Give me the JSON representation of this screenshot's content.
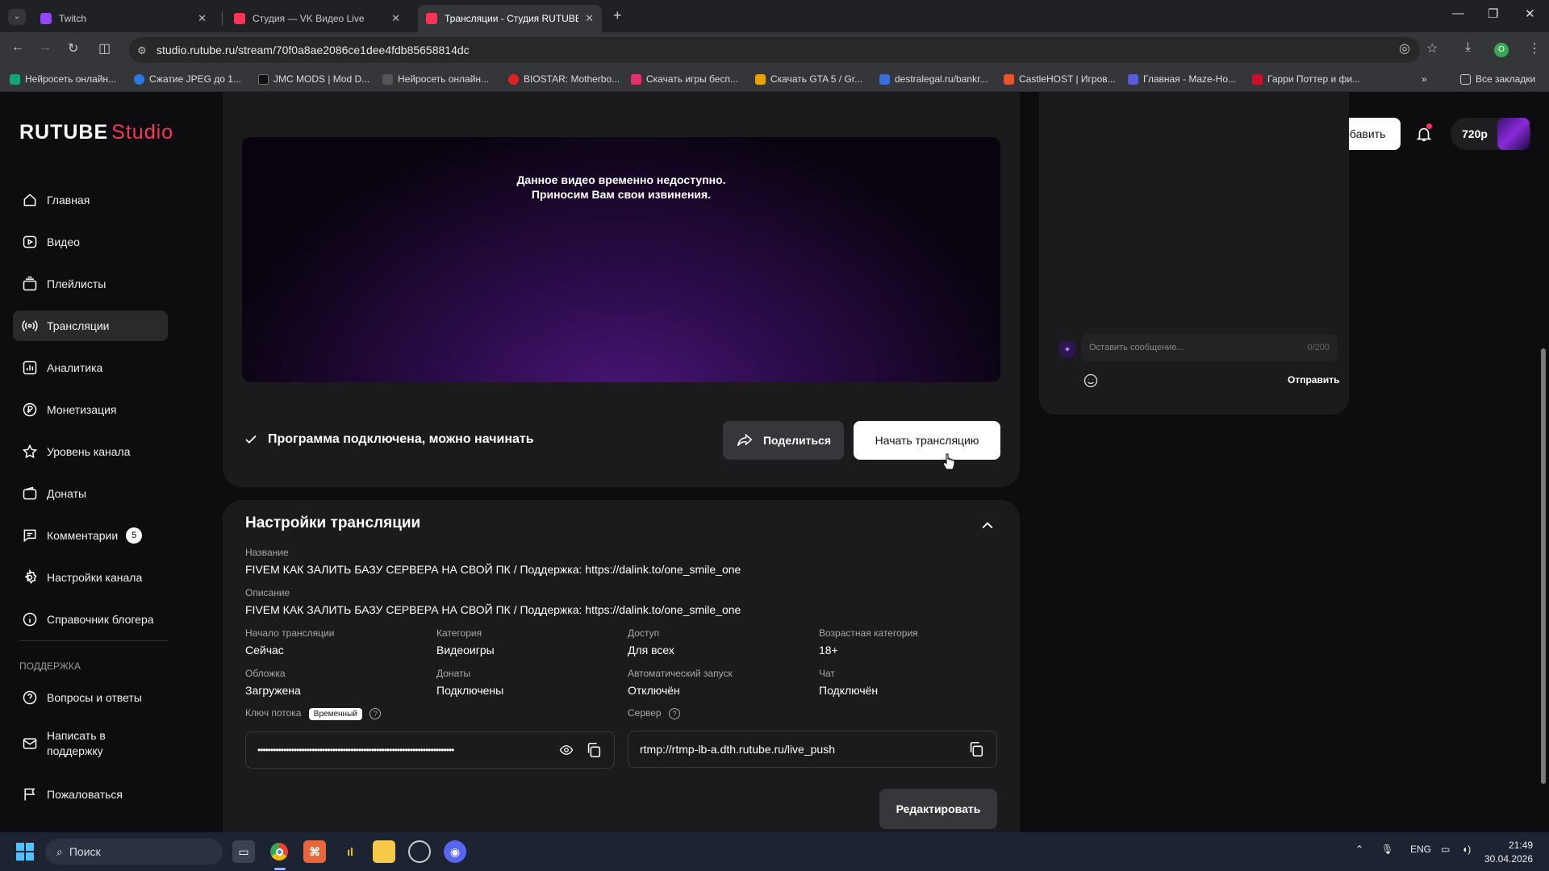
{
  "browser": {
    "tabs": [
      {
        "title": "Twitch",
        "color": "#9146ff"
      },
      {
        "title": "Студия — VK Видео Live",
        "color": "#ff3355"
      },
      {
        "title": "Трансляции - Студия RUTUBE",
        "color": "#ff3355"
      }
    ],
    "url": "studio.rutube.ru/stream/70f0a8ae2086ce1dee4fdb85658814dc",
    "bookmarks": [
      "Нейросеть онлайн...",
      "Сжатие JPEG до 1...",
      "JMC MODS | Mod D...",
      "Нейросеть онлайн...",
      "BIOSTAR: Motherbo...",
      "Скачать игры бесп...",
      "Скачать GTA 5 / Gr...",
      "destralegal.ru/bankr...",
      "CastleHOST | Игров...",
      "Главная - Maze-Ho...",
      "Гарри Поттер и фи..."
    ],
    "all_bookmarks": "Все закладки",
    "profile_initial": "O"
  },
  "app": {
    "logo_main": "RUTUBE",
    "logo_sub": "Studio",
    "add_button": "Добавить",
    "quality": "720p"
  },
  "sidebar": {
    "items": [
      {
        "label": "Главная"
      },
      {
        "label": "Видео"
      },
      {
        "label": "Плейлисты"
      },
      {
        "label": "Трансляции"
      },
      {
        "label": "Аналитика"
      },
      {
        "label": "Монетизация"
      },
      {
        "label": "Уровень канала"
      },
      {
        "label": "Донаты"
      },
      {
        "label": "Комментарии",
        "badge": "5"
      },
      {
        "label": "Настройки канала"
      },
      {
        "label": "Справочник блогера"
      }
    ],
    "support_heading": "ПОДДЕРЖКА",
    "support_items": [
      {
        "label": "Вопросы и ответы"
      },
      {
        "label": "Написать в поддержку"
      },
      {
        "label": "Пожаловаться"
      }
    ]
  },
  "player": {
    "message_line1": "Данное видео временно недоступно.",
    "message_line2": "Приносим Вам свои извинения."
  },
  "stream": {
    "status": "Программа подключена, можно начинать",
    "share_button": "Поделиться",
    "start_button": "Начать трансляцию"
  },
  "chat": {
    "placeholder": "Оставить сообщение...",
    "counter": "0/200",
    "send": "Отправить"
  },
  "settings": {
    "title": "Настройки трансляции",
    "name_label": "Название",
    "name_value": "FIVEM КАК ЗАЛИТЬ БАЗУ СЕРВЕРА НА СВОЙ ПК / Поддержка: https://dalink.to/one_smile_one",
    "desc_label": "Описание",
    "desc_value": "FIVEM КАК ЗАЛИТЬ БАЗУ СЕРВЕРА НА СВОЙ ПК / Поддержка: https://dalink.to/one_smile_one",
    "grid": [
      {
        "label": "Начало трансляции",
        "value": "Сейчас"
      },
      {
        "label": "Категория",
        "value": "Видеоигры"
      },
      {
        "label": "Доступ",
        "value": "Для всех"
      },
      {
        "label": "Возрастная категория",
        "value": "18+"
      },
      {
        "label": "Обложка",
        "value": "Загружена"
      },
      {
        "label": "Донаты",
        "value": "Подключены"
      },
      {
        "label": "Автоматический запуск",
        "value": "Отключён"
      },
      {
        "label": "Чат",
        "value": "Подключён"
      }
    ],
    "key_label": "Ключ потока",
    "key_tag": "Временный",
    "key_value": "••••••••••••••••••••••••••••••••••••••••••••••••••••••••••••••••••••••••••••",
    "server_label": "Сервер",
    "server_value": "rtmp://rtmp-lb-a.dth.rutube.ru/live_push",
    "edit_button": "Редактировать"
  },
  "taskbar": {
    "search": "Поиск",
    "lang": "ENG",
    "time": "21:49",
    "date": "30.04.2026"
  }
}
